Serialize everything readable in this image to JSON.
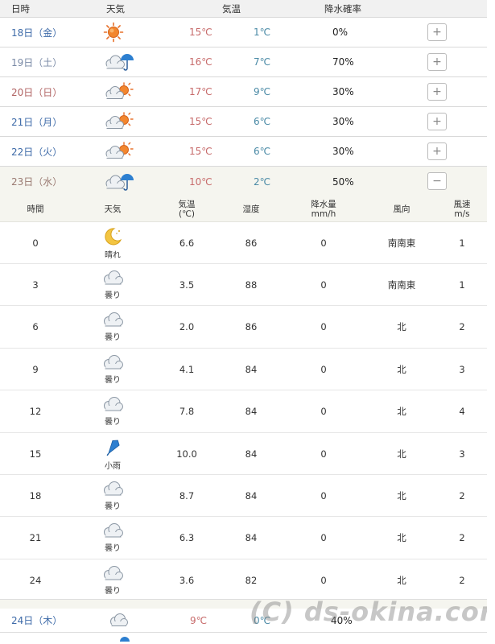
{
  "header": {
    "date": "日時",
    "weather": "天気",
    "temp": "気温",
    "pop": "降水確率"
  },
  "days": [
    {
      "date": "18日（金）",
      "kind": "weekday",
      "icon": "sun-icon",
      "max": "15℃",
      "min": "1℃",
      "pop": "0%",
      "toggle": "+"
    },
    {
      "date": "19日（土）",
      "kind": "sat",
      "icon": "cloud-umbrella-icon",
      "max": "16℃",
      "min": "7℃",
      "pop": "70%",
      "toggle": "+"
    },
    {
      "date": "20日（日）",
      "kind": "sun",
      "icon": "cloud-sun-icon",
      "max": "17℃",
      "min": "9℃",
      "pop": "30%",
      "toggle": "+"
    },
    {
      "date": "21日（月）",
      "kind": "weekday",
      "icon": "cloud-sun-icon",
      "max": "15℃",
      "min": "6℃",
      "pop": "30%",
      "toggle": "+"
    },
    {
      "date": "22日（火）",
      "kind": "weekday",
      "icon": "cloud-sun-icon",
      "max": "15℃",
      "min": "6℃",
      "pop": "30%",
      "toggle": "+"
    },
    {
      "date": "23日（水）",
      "kind": "sel",
      "icon": "cloud-umbrella-icon",
      "max": "10℃",
      "min": "2℃",
      "pop": "50%",
      "toggle": "−"
    }
  ],
  "hourly_header": {
    "hour": "時間",
    "weather": "天気",
    "temp_1": "気温",
    "temp_2": "(℃)",
    "humidity": "湿度",
    "rain_1": "降水量",
    "rain_2": "mm/h",
    "wind_dir": "風向",
    "wind_1": "風速",
    "wind_2": "m/s"
  },
  "hourly": [
    {
      "hour": "0",
      "icon": "moon-icon",
      "label": "晴れ",
      "temp": "6.6",
      "hum": "86",
      "rain": "0",
      "dir": "南南東",
      "speed": "1"
    },
    {
      "hour": "3",
      "icon": "cloud-icon",
      "label": "曇り",
      "temp": "3.5",
      "hum": "88",
      "rain": "0",
      "dir": "南南東",
      "speed": "1"
    },
    {
      "hour": "6",
      "icon": "cloud-icon",
      "label": "曇り",
      "temp": "2.0",
      "hum": "86",
      "rain": "0",
      "dir": "北",
      "speed": "2"
    },
    {
      "hour": "9",
      "icon": "cloud-icon",
      "label": "曇り",
      "temp": "4.1",
      "hum": "84",
      "rain": "0",
      "dir": "北",
      "speed": "3"
    },
    {
      "hour": "12",
      "icon": "cloud-icon",
      "label": "曇り",
      "temp": "7.8",
      "hum": "84",
      "rain": "0",
      "dir": "北",
      "speed": "4"
    },
    {
      "hour": "15",
      "icon": "umbrella-icon",
      "label": "小雨",
      "temp": "10.0",
      "hum": "84",
      "rain": "0",
      "dir": "北",
      "speed": "3"
    },
    {
      "hour": "18",
      "icon": "cloud-icon",
      "label": "曇り",
      "temp": "8.7",
      "hum": "84",
      "rain": "0",
      "dir": "北",
      "speed": "2"
    },
    {
      "hour": "21",
      "icon": "cloud-icon",
      "label": "曇り",
      "temp": "6.3",
      "hum": "84",
      "rain": "0",
      "dir": "北",
      "speed": "2"
    },
    {
      "hour": "24",
      "icon": "cloud-icon",
      "label": "曇り",
      "temp": "3.6",
      "hum": "82",
      "rain": "0",
      "dir": "北",
      "speed": "2"
    }
  ],
  "next_day": {
    "date": "24日（木）",
    "icon": "cloud-icon",
    "max": "9℃",
    "min": "0℃",
    "pop": "40%"
  },
  "watermark": "(C) ds-okina.com",
  "colors": {
    "weekday": "#3d6aa8",
    "sunday": "#b06262",
    "max_temp": "#c76b6b",
    "min_temp": "#4a8aa6",
    "selected_bg": "#f5f5ef"
  }
}
